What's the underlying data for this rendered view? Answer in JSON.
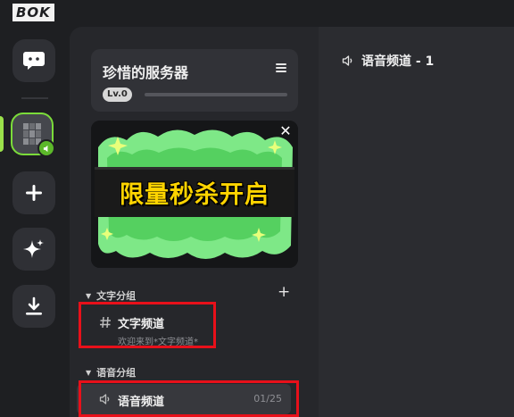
{
  "app": {
    "logo_text": "BOK"
  },
  "rail": {
    "items": [
      {
        "name": "home",
        "icon": "gamepad-chat-icon"
      },
      {
        "name": "server",
        "icon": "server-avatar",
        "badge_icon": "voice-badge-icon"
      },
      {
        "name": "add",
        "icon": "plus-icon"
      },
      {
        "name": "explore",
        "icon": "sparkle-icon"
      },
      {
        "name": "download",
        "icon": "download-icon"
      }
    ]
  },
  "server": {
    "name": "珍惜的服务器",
    "level_badge": "Lv.0",
    "level_progress": 0
  },
  "banner": {
    "headline": "限量秒杀开启",
    "colors": {
      "green": "#7ee887",
      "yellow": "#ffd400",
      "bg": "#151618"
    }
  },
  "channels": {
    "text_category": {
      "label": "文字分组"
    },
    "text_channel": {
      "name": "文字频道",
      "description": "欢迎来到*文字频道*"
    },
    "voice_category": {
      "label": "语音分组"
    },
    "voice_channel": {
      "name": "语音频道",
      "count": "01/25"
    }
  },
  "main": {
    "title": "语音频道 - 1"
  },
  "colors": {
    "accent_green": "#7bdc3a",
    "highlight_red": "#e8101a"
  }
}
